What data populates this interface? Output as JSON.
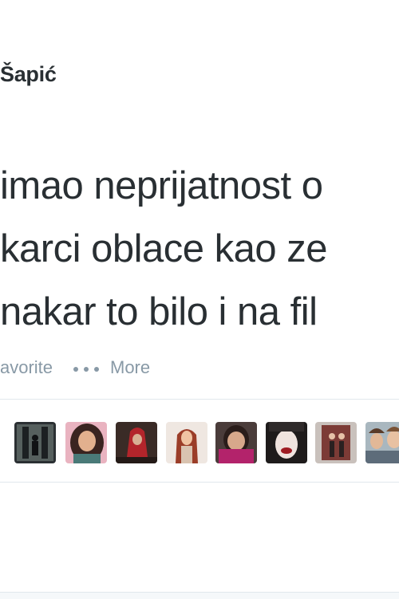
{
  "tweet": {
    "author_name": "Šapić",
    "text_lines": [
      "imao neprijatnost o",
      "karci oblace kao ze",
      "nakar to bilo i na fil"
    ]
  },
  "actions": {
    "favorite_label": "avorite",
    "more_label": "More"
  },
  "favorited_by": {
    "avatar_count_visible": 8
  },
  "colors": {
    "text": "#292f33",
    "muted": "#8899a6",
    "divider": "#e1e8ed"
  }
}
